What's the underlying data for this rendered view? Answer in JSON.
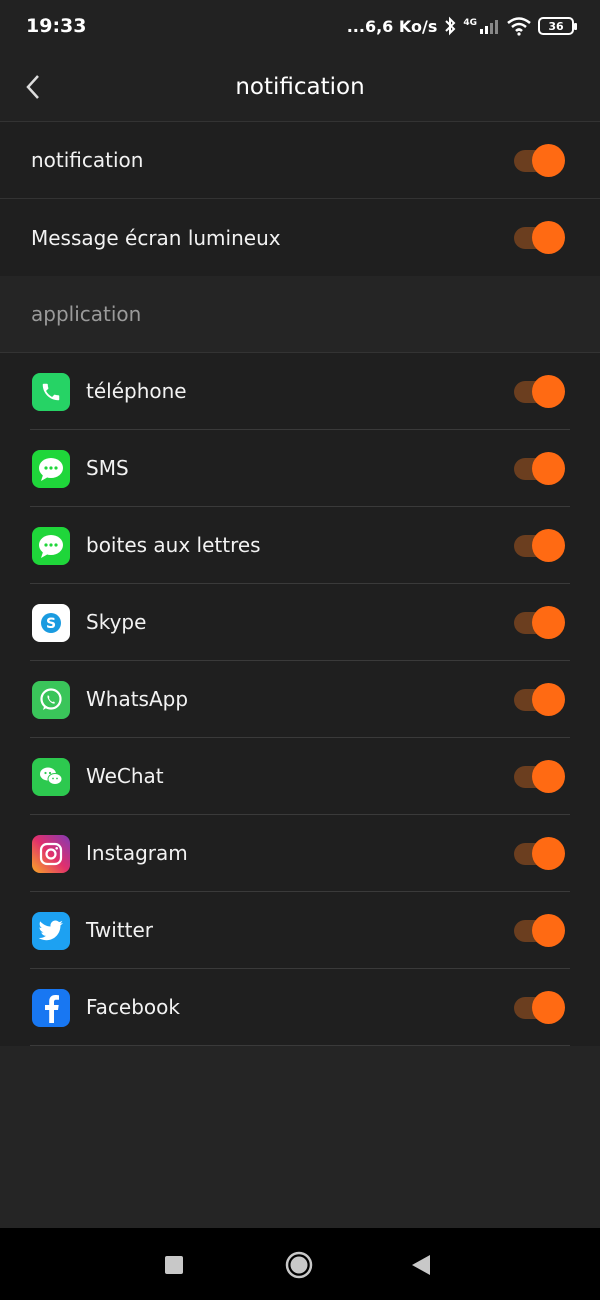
{
  "status_bar": {
    "time": "19:33",
    "speed": "...6,6 Ko/s",
    "network": "4G",
    "battery": "36"
  },
  "header": {
    "title": "notification"
  },
  "settings": [
    {
      "label": "notification",
      "enabled": true
    },
    {
      "label": "Message écran lumineux",
      "enabled": true
    }
  ],
  "section": {
    "label": "application"
  },
  "apps": [
    {
      "label": "téléphone",
      "icon": "phone-icon",
      "color": "#26d365",
      "enabled": true
    },
    {
      "label": "SMS",
      "icon": "message-icon",
      "color": "#1fd63a",
      "enabled": true
    },
    {
      "label": "boites aux lettres",
      "icon": "message-icon",
      "color": "#1fd63a",
      "enabled": true
    },
    {
      "label": "Skype",
      "icon": "skype-icon",
      "color": "#ffffff",
      "enabled": true
    },
    {
      "label": "WhatsApp",
      "icon": "whatsapp-icon",
      "color": "#3ac55a",
      "enabled": true
    },
    {
      "label": "WeChat",
      "icon": "wechat-icon",
      "color": "#2dc94f",
      "enabled": true
    },
    {
      "label": "Instagram",
      "icon": "instagram-icon",
      "color": "#d6286f",
      "enabled": true
    },
    {
      "label": "Twitter",
      "icon": "twitter-icon",
      "color": "#1da1f2",
      "enabled": true
    },
    {
      "label": "Facebook",
      "icon": "facebook-icon",
      "color": "#1877f2",
      "enabled": true
    }
  ],
  "colors": {
    "toggle_thumb": "#ff6a13",
    "toggle_track": "#6b3e1f"
  }
}
